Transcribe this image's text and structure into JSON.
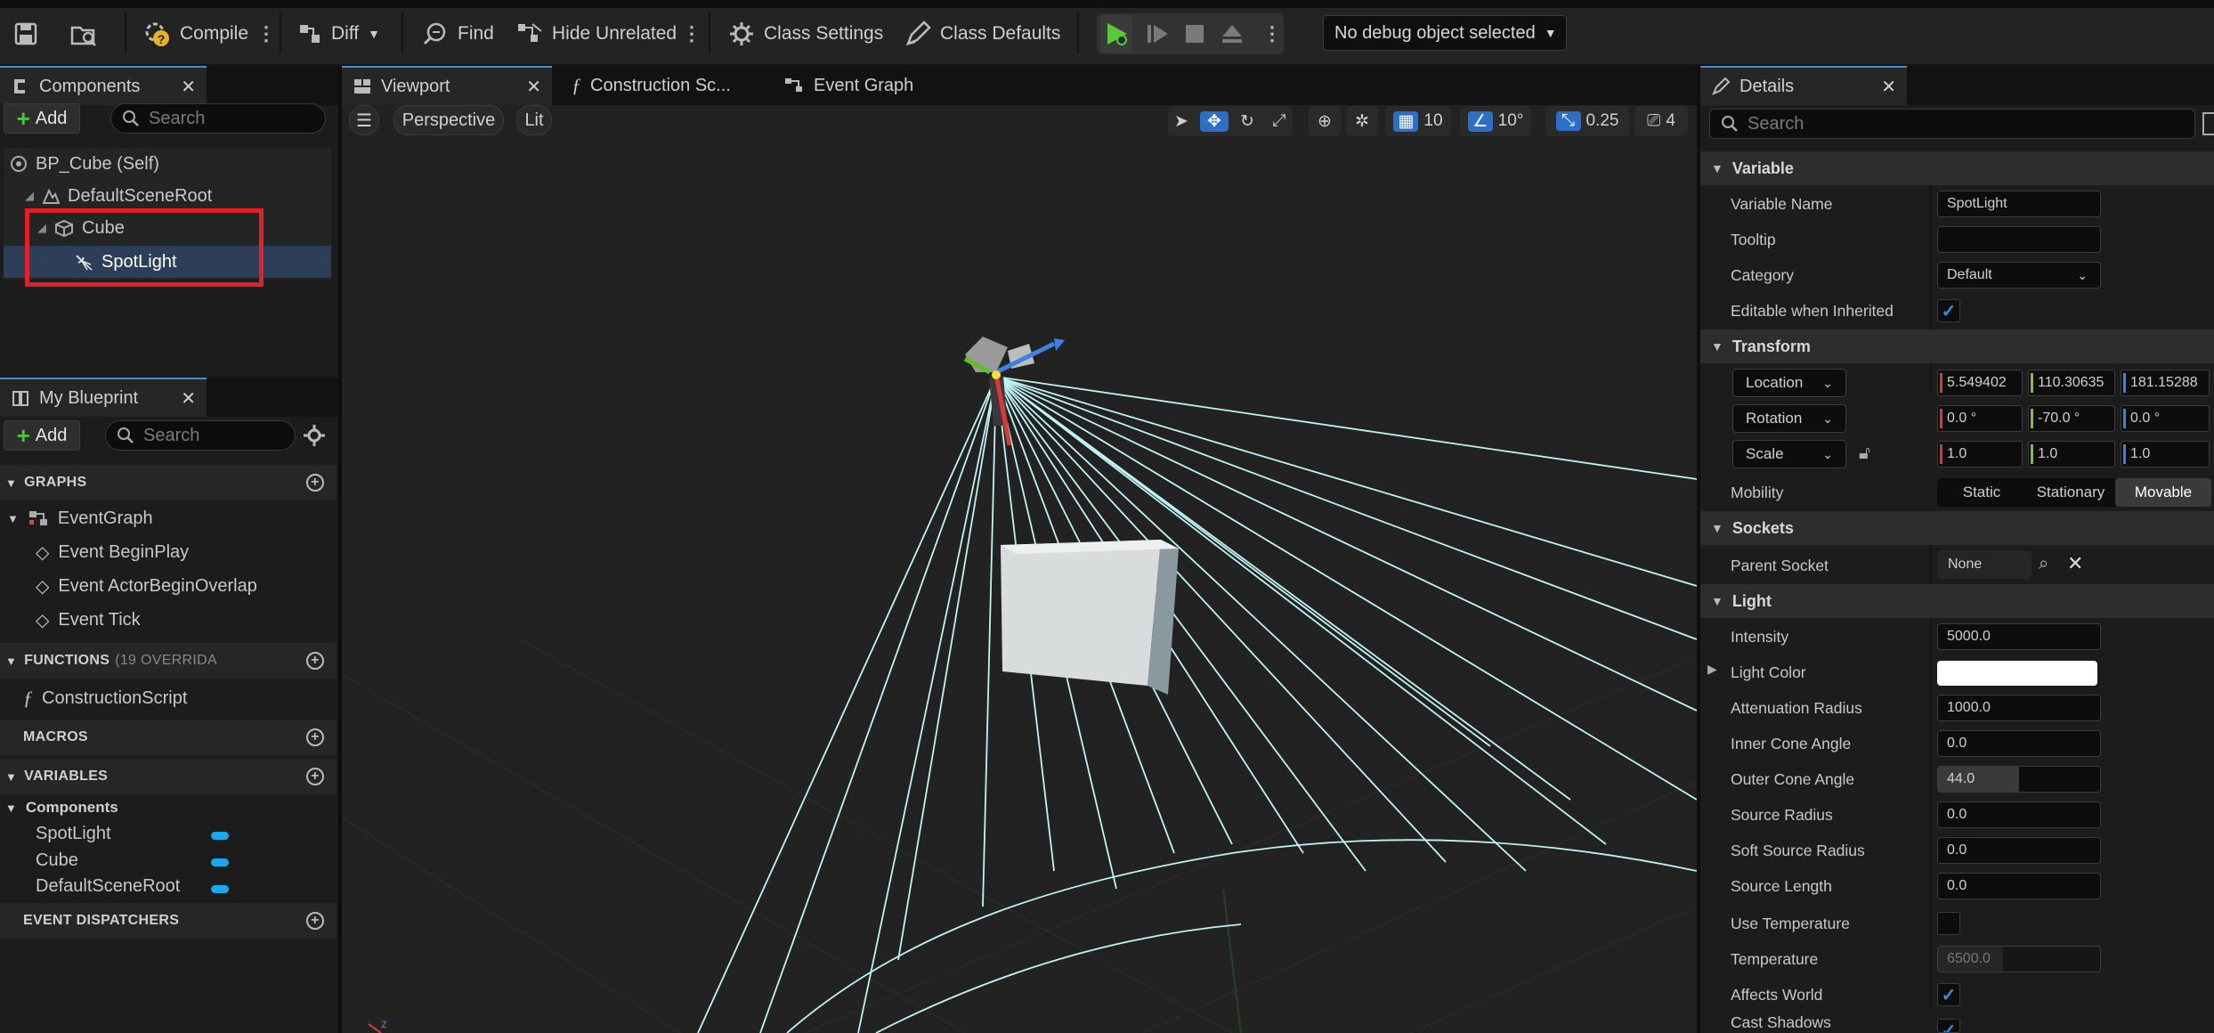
{
  "toolbar": {
    "compile_label": "Compile",
    "diff_label": "Diff",
    "find_label": "Find",
    "hide_unrelated_label": "Hide Unrelated",
    "class_settings_label": "Class Settings",
    "class_defaults_label": "Class Defaults",
    "debug_object_label": "No debug object selected"
  },
  "components_panel": {
    "tab_label": "Components",
    "add_label": "Add",
    "search_placeholder": "Search",
    "tree": {
      "root": "BP_Cube (Self)",
      "scene_root": "DefaultSceneRoot",
      "cube": "Cube",
      "spotlight": "SpotLight"
    }
  },
  "my_blueprint": {
    "tab_label": "My Blueprint",
    "add_label": "Add",
    "search_placeholder": "Search",
    "graphs_header": "GRAPHS",
    "event_graph": "EventGraph",
    "events": [
      "Event BeginPlay",
      "Event ActorBeginOverlap",
      "Event Tick"
    ],
    "functions_header": "FUNCTIONS",
    "functions_note": "(19 OVERRIDA",
    "construction_script": "ConstructionScript",
    "macros_header": "MACROS",
    "variables_header": "VARIABLES",
    "components_category": "Components",
    "variables": [
      "SpotLight",
      "Cube",
      "DefaultSceneRoot"
    ],
    "event_dispatchers_header": "EVENT DISPATCHERS"
  },
  "editor_tabs": {
    "viewport": "Viewport",
    "construction": "Construction Sc...",
    "event_graph": "Event Graph"
  },
  "viewport": {
    "perspective_label": "Perspective",
    "lit_label": "Lit",
    "grid_snap": "10",
    "rotation_snap": "10°",
    "scale_snap": "0.25",
    "camera_speed": "4"
  },
  "details": {
    "tab_label": "Details",
    "search_placeholder": "Search",
    "variable_section": "Variable",
    "variable_name_label": "Variable Name",
    "variable_name_value": "SpotLight",
    "tooltip_label": "Tooltip",
    "tooltip_value": "",
    "category_label": "Category",
    "category_value": "Default",
    "editable_label": "Editable when Inherited",
    "editable_checked": true,
    "transform_section": "Transform",
    "location_label": "Location",
    "location": [
      "5.549402",
      "110.30635",
      "181.15288"
    ],
    "rotation_label": "Rotation",
    "rotation": [
      "0.0 °",
      "-70.0 °",
      "0.0 °"
    ],
    "scale_label": "Scale",
    "scale": [
      "1.0",
      "1.0",
      "1.0"
    ],
    "mobility_label": "Mobility",
    "mobility_options": [
      "Static",
      "Stationary",
      "Movable"
    ],
    "mobility_selected": "Movable",
    "sockets_section": "Sockets",
    "parent_socket_label": "Parent Socket",
    "parent_socket_value": "None",
    "light_section": "Light",
    "intensity_label": "Intensity",
    "intensity_value": "5000.0",
    "light_color_label": "Light Color",
    "light_color_value": "#ffffff",
    "attenuation_label": "Attenuation Radius",
    "attenuation_value": "1000.0",
    "inner_cone_label": "Inner Cone Angle",
    "inner_cone_value": "0.0",
    "outer_cone_label": "Outer Cone Angle",
    "outer_cone_value": "44.0",
    "source_radius_label": "Source Radius",
    "source_radius_value": "0.0",
    "soft_source_radius_label": "Soft Source Radius",
    "soft_source_radius_value": "0.0",
    "source_length_label": "Source Length",
    "source_length_value": "0.0",
    "use_temperature_label": "Use Temperature",
    "temperature_label": "Temperature",
    "temperature_value": "6500.0",
    "affects_world_label": "Affects World",
    "cast_shadows_label": "Cast Shadows"
  },
  "colors": {
    "accent": "#3d8fe0",
    "selection": "#2d3e58",
    "highlight_box": "#e0202a",
    "light_cone": "#bff3f5",
    "variable_pill": "#18a8ee"
  }
}
